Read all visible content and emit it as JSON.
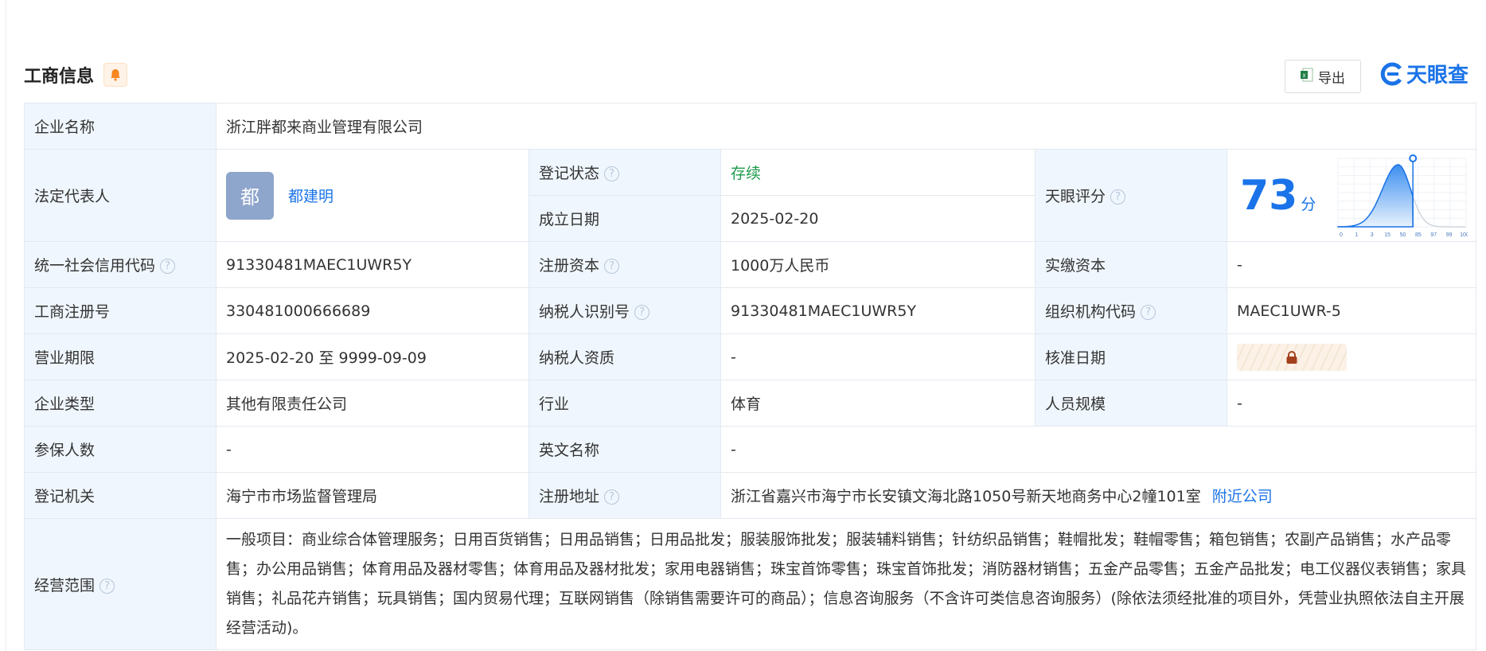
{
  "header": {
    "title": "工商信息",
    "bell_icon": "bell-icon",
    "export_label": "导出",
    "logo_text": "天眼查"
  },
  "rows": {
    "company_name": {
      "label": "企业名称",
      "value": "浙江胖都来商业管理有限公司"
    },
    "legal_rep": {
      "label": "法定代表人",
      "avatar": "都",
      "name": "都建明"
    },
    "reg_status": {
      "label": "登记状态",
      "value": "存续"
    },
    "found_date": {
      "label": "成立日期",
      "value": "2025-02-20"
    },
    "score": {
      "label": "天眼评分",
      "value": "73",
      "unit": "分"
    },
    "credit_code": {
      "label": "统一社会信用代码",
      "value": "91330481MAEC1UWR5Y"
    },
    "reg_capital": {
      "label": "注册资本",
      "value": "1000万人民币"
    },
    "paid_capital": {
      "label": "实缴资本",
      "value": "-"
    },
    "reg_no": {
      "label": "工商注册号",
      "value": "330481000666689"
    },
    "taxpayer_id": {
      "label": "纳税人识别号",
      "value": "91330481MAEC1UWR5Y"
    },
    "org_code": {
      "label": "组织机构代码",
      "value": "MAEC1UWR-5"
    },
    "term": {
      "label": "营业期限",
      "value": "2025-02-20 至 9999-09-09"
    },
    "taxpayer_qual": {
      "label": "纳税人资质",
      "value": "-"
    },
    "approve_date": {
      "label": "核准日期"
    },
    "company_type": {
      "label": "企业类型",
      "value": "其他有限责任公司"
    },
    "industry": {
      "label": "行业",
      "value": "体育"
    },
    "staff_size": {
      "label": "人员规模",
      "value": "-"
    },
    "insured": {
      "label": "参保人数",
      "value": "-"
    },
    "english_name": {
      "label": "英文名称",
      "value": "-"
    },
    "authority": {
      "label": "登记机关",
      "value": "海宁市市场监督管理局"
    },
    "address": {
      "label": "注册地址",
      "value": "浙江省嘉兴市海宁市长安镇文海北路1050号新天地商务中心2幢101室",
      "link": "附近公司"
    },
    "scope": {
      "label": "经营范围",
      "value": "一般项目：商业综合体管理服务；日用百货销售；日用品销售；日用品批发；服装服饰批发；服装辅料销售；针纺织品销售；鞋帽批发；鞋帽零售；箱包销售；农副产品销售；水产品零售；办公用品销售；体育用品及器材零售；体育用品及器材批发；家用电器销售；珠宝首饰零售；珠宝首饰批发；消防器材销售；五金产品零售；五金产品批发；电工仪器仪表销售；家具销售；礼品花卉销售；玩具销售；国内贸易代理；互联网销售（除销售需要许可的商品）；信息咨询服务（不含许可类信息咨询服务）(除依法须经批准的项目外，凭营业执照依法自主开展经营活动)。"
    }
  },
  "chart_data": {
    "type": "area",
    "x_ticks": [
      "0",
      "1",
      "3",
      "15",
      "50",
      "85",
      "97",
      "99",
      "100"
    ],
    "marker_value": 73,
    "series": "score distribution"
  }
}
